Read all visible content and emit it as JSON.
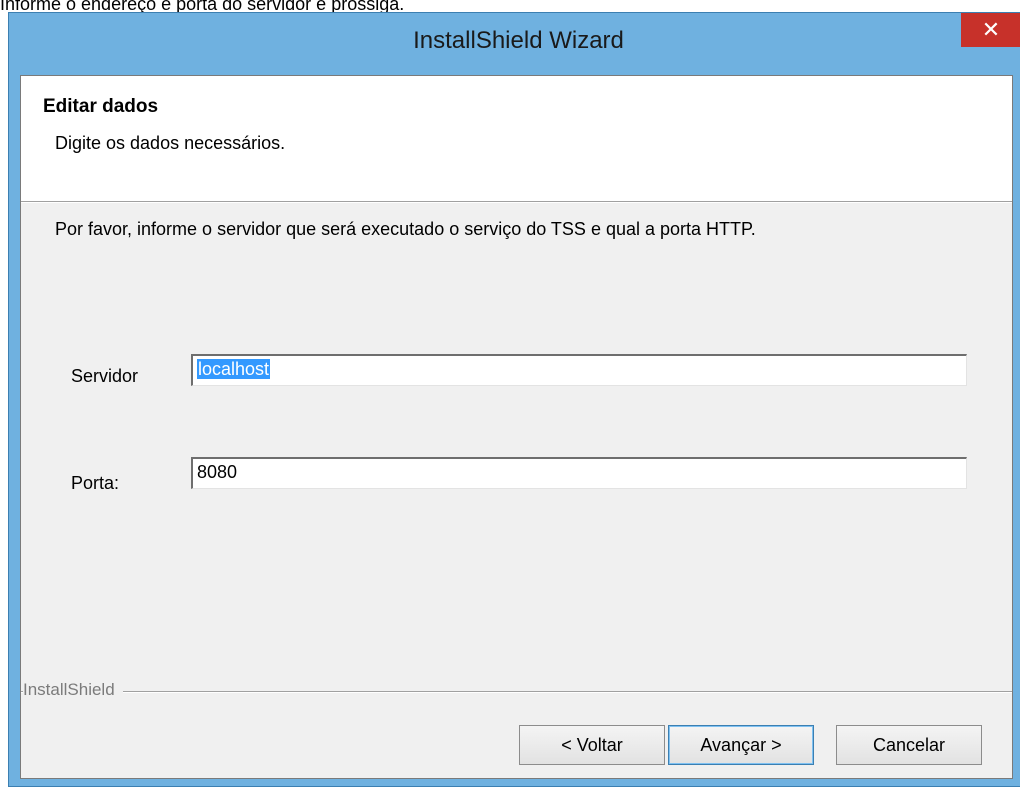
{
  "caption": "Informe o endereço e porta do servidor e prossiga.",
  "window": {
    "title": "InstallShield Wizard",
    "close_glyph": "✕"
  },
  "header": {
    "title": "Editar dados",
    "subtitle": "Digite os dados necessários."
  },
  "instruction": "Por favor, informe o servidor que será executado o serviço do TSS e qual a porta HTTP.",
  "fields": {
    "servidor_label": "Servidor",
    "servidor_value": "localhost",
    "porta_label": "Porta:",
    "porta_value": "8080"
  },
  "brand": "InstallShield",
  "buttons": {
    "back": "< Voltar",
    "next": "Avançar >",
    "cancel": "Cancelar"
  },
  "colors": {
    "title_bar": "#6fb1e0",
    "close_button": "#c7312a",
    "selection": "#3399ff",
    "dialog_background": "#f0f0f0"
  }
}
